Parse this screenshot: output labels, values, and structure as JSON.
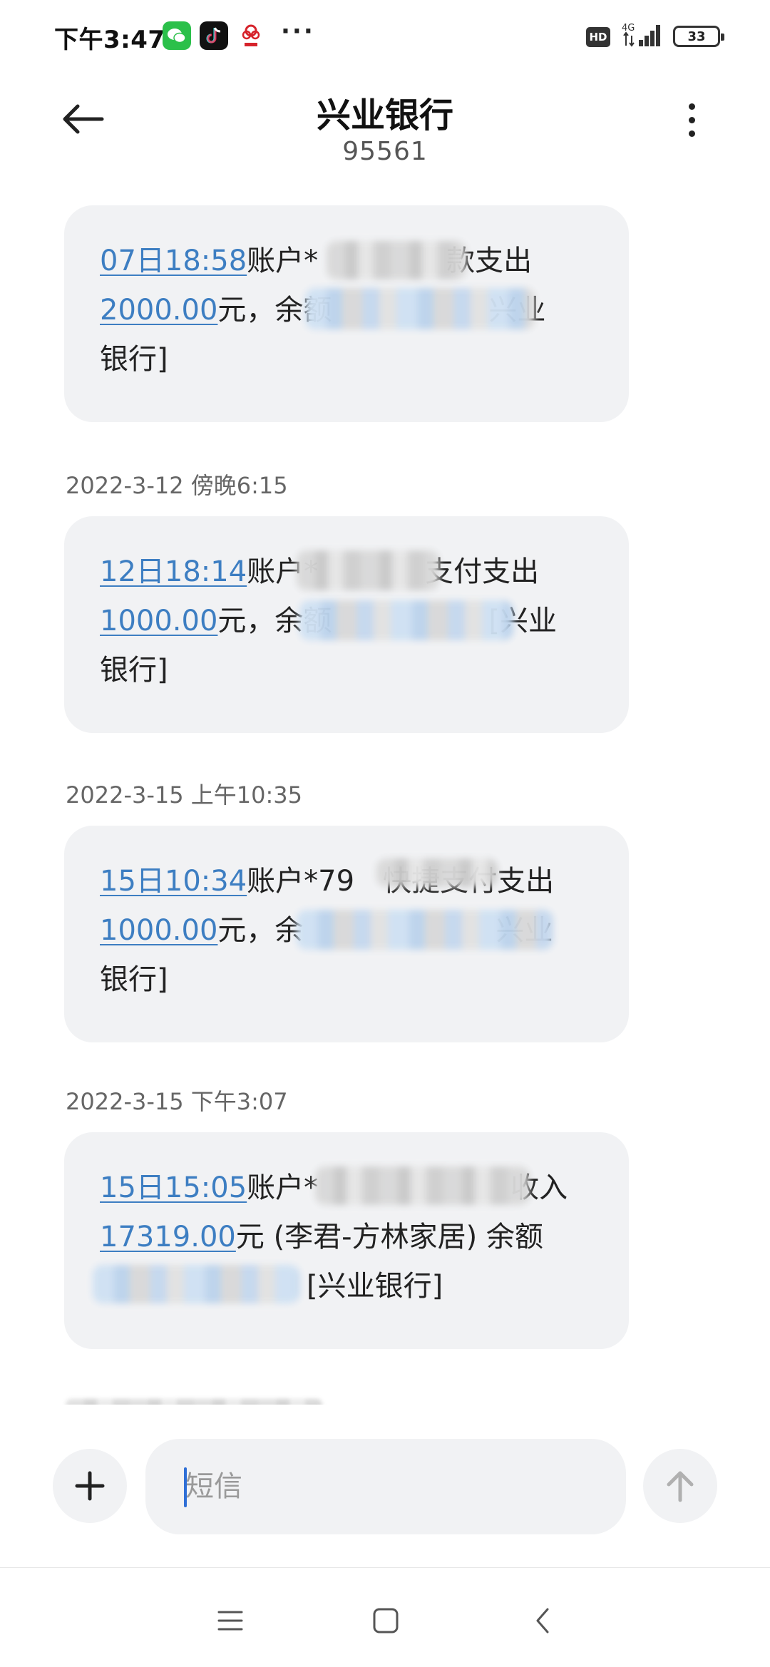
{
  "status_bar": {
    "time": "下午3:47",
    "more": "···",
    "hd": "HD",
    "network": "4G",
    "battery": "33"
  },
  "header": {
    "title": "兴业银行",
    "subtitle": "95561"
  },
  "messages": [
    {
      "timestamp": "",
      "link": "07日18:58",
      "text_a": "账户*",
      "text_b": "款支出",
      "amount": "2000.00",
      "text_c": "元，余额",
      "text_d": "兴业",
      "text_e": "银行]"
    },
    {
      "timestamp": "2022-3-12 傍晚6:15",
      "link": "12日18:14",
      "text_a": "账户*",
      "text_b": "支付支出",
      "amount": "1000.00",
      "text_c": "元，余额",
      "text_d": "[兴业",
      "text_e": "银行]"
    },
    {
      "timestamp": "2022-3-15 上午10:35",
      "link": "15日10:34",
      "text_a": "账户*79",
      "text_b": "快捷支付支出",
      "amount": "1000.00",
      "text_c": "元，余",
      "text_d": "兴业",
      "text_e": "银行]"
    },
    {
      "timestamp": "2022-3-15 下午3:07",
      "link": "15日15:05",
      "text_a": "账户*",
      "text_b": "收入",
      "amount": "17319.00",
      "text_c": "元 (李君-方林家居) 余额",
      "text_d": "",
      "text_e": "[兴业银行]"
    }
  ],
  "compose": {
    "placeholder": "短信"
  },
  "colors": {
    "link": "#3d7ec2",
    "bubble": "#f1f2f4",
    "caret": "#2f6fd6"
  }
}
